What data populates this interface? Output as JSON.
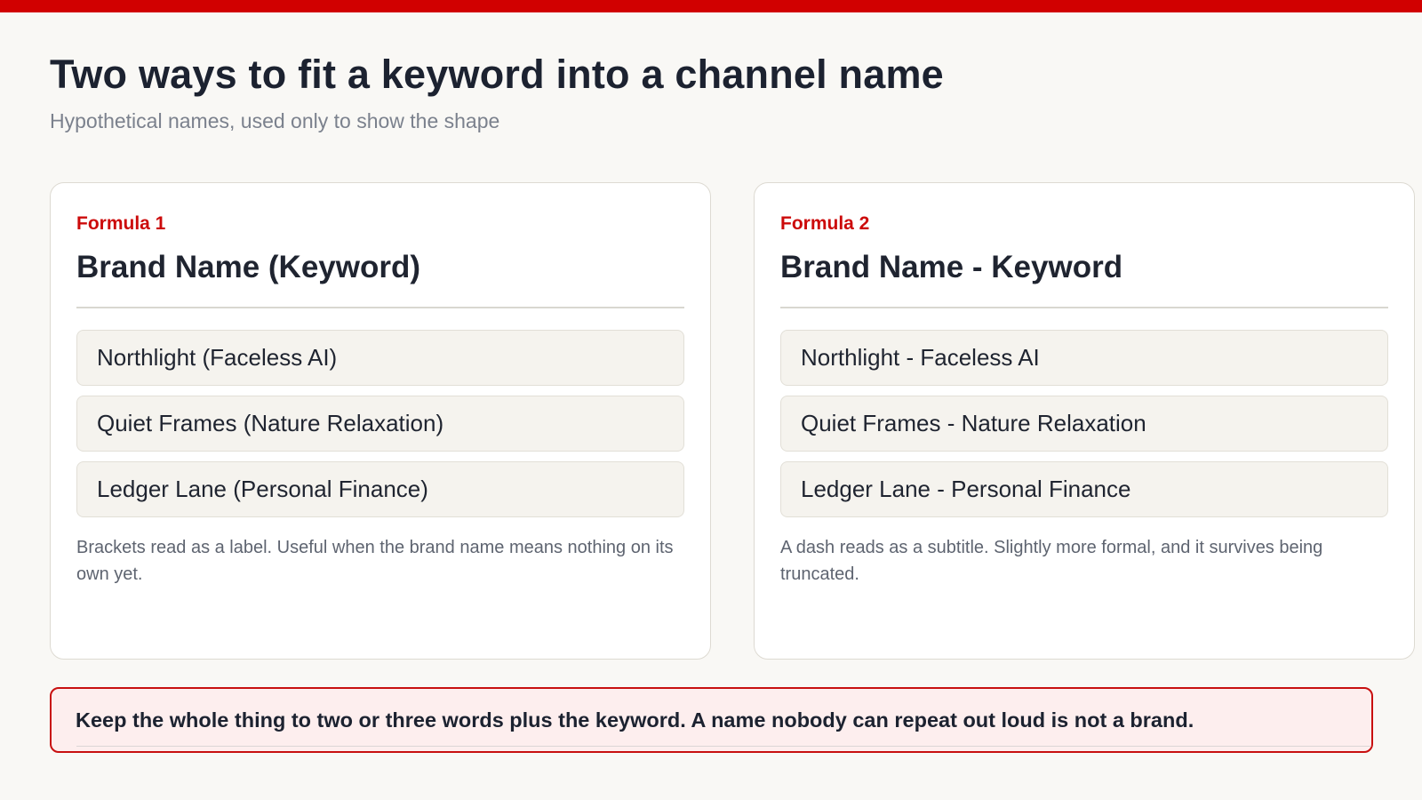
{
  "header": {
    "title": "Two ways to fit a keyword into a channel name",
    "subtitle": "Hypothetical names, used only to show the shape"
  },
  "formulas": [
    {
      "kicker": "Formula 1",
      "pattern": "Brand Name (Keyword)",
      "examples": [
        "Northlight (Faceless AI)",
        "Quiet Frames (Nature Relaxation)",
        "Ledger Lane (Personal Finance)"
      ],
      "note": "Brackets read as a label. Useful when the brand name means nothing on its own yet."
    },
    {
      "kicker": "Formula 2",
      "pattern": "Brand Name - Keyword",
      "examples": [
        "Northlight - Faceless AI",
        "Quiet Frames - Nature Relaxation",
        "Ledger Lane - Personal Finance"
      ],
      "note": "A dash reads as a subtitle. Slightly more formal, and it survives being truncated."
    }
  ],
  "callout": {
    "text": "Keep the whole thing to two or three words plus the keyword. A name nobody can repeat out loud is not a brand."
  },
  "colors": {
    "accent": "#d10000",
    "background": "#f9f8f5",
    "card": "#ffffff",
    "callout_bg": "#fdeeee"
  }
}
